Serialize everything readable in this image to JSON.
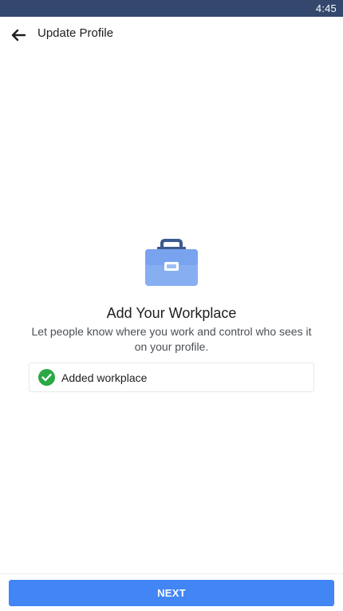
{
  "status_bar": {
    "time": "4:45"
  },
  "app_bar": {
    "title": "Update Profile",
    "back_icon": "back-arrow-icon"
  },
  "main": {
    "illustration_icon": "briefcase-icon",
    "headline": "Add Your Workplace",
    "description": "Let people know where you work and control who sees it on your profile.",
    "status_item": {
      "icon": "check-circle-icon",
      "label": "Added workplace"
    }
  },
  "footer": {
    "next_label": "NEXT"
  },
  "colors": {
    "status_bar": "#34486e",
    "primary_button": "#4285f4",
    "success": "#29a844",
    "briefcase_body": "#88aef2",
    "briefcase_handle": "#3b5a8f"
  }
}
